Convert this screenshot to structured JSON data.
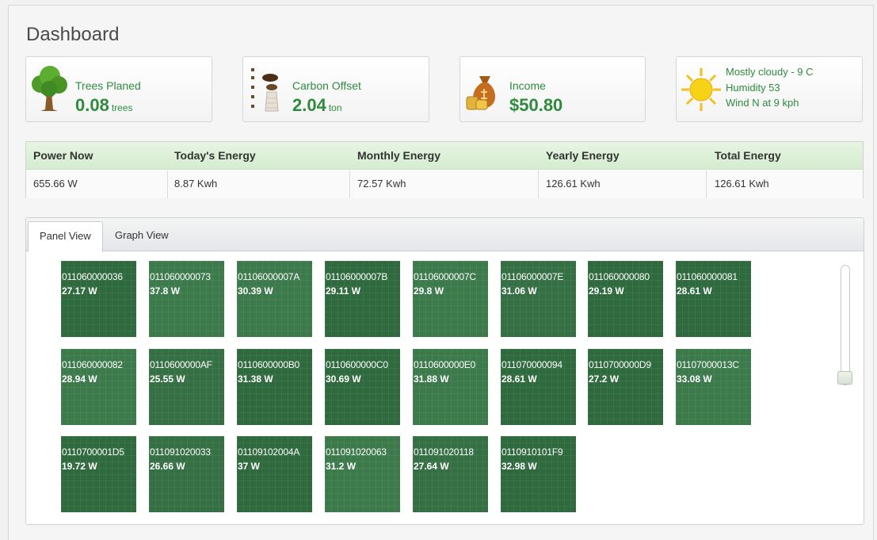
{
  "dashboard": {
    "title": "Dashboard"
  },
  "cards": {
    "trees": {
      "label": "Trees Planed",
      "value": "0.08",
      "unit": "trees",
      "icon": "tree-icon"
    },
    "carbon": {
      "label": "Carbon Offset",
      "value": "2.04",
      "unit": "ton",
      "icon": "factory-smoke-icon"
    },
    "income": {
      "label": "Income",
      "value": "$50.80",
      "icon": "money-bag-icon"
    },
    "weather": {
      "line1": "Mostly cloudy - 9 C",
      "line2": "Humidity 53",
      "line3": "Wind N at 9 kph",
      "icon": "sun-icon"
    }
  },
  "energy": {
    "headers": [
      "Power Now",
      "Today's Energy",
      "Monthly Energy",
      "Yearly Energy",
      "Total Energy"
    ],
    "values": [
      "655.66 W",
      "8.87 Kwh",
      "72.57 Kwh",
      "126.61 Kwh",
      "126.61 Kwh"
    ]
  },
  "tabs": [
    {
      "label": "Panel View",
      "active": true
    },
    {
      "label": "Graph View",
      "active": false
    }
  ],
  "panels": [
    {
      "id": "011060000036",
      "power": "27.17 W"
    },
    {
      "id": "011060000073",
      "power": "37.8 W"
    },
    {
      "id": "01106000007A",
      "power": "30.39 W"
    },
    {
      "id": "01106000007B",
      "power": "29.11 W"
    },
    {
      "id": "01106000007C",
      "power": "29.8 W"
    },
    {
      "id": "01106000007E",
      "power": "31.06 W"
    },
    {
      "id": "011060000080",
      "power": "29.19 W"
    },
    {
      "id": "011060000081",
      "power": "28.61 W"
    },
    {
      "id": "011060000082",
      "power": "28.94 W"
    },
    {
      "id": "0110600000AF",
      "power": "25.55 W"
    },
    {
      "id": "0110600000B0",
      "power": "31.38 W"
    },
    {
      "id": "0110600000C0",
      "power": "30.69 W"
    },
    {
      "id": "0110600000E0",
      "power": "31.88 W"
    },
    {
      "id": "011070000094",
      "power": "28.61 W"
    },
    {
      "id": "0110700000D9",
      "power": "27.2 W"
    },
    {
      "id": "01107000013C",
      "power": "33.08 W"
    },
    {
      "id": "0110700001D5",
      "power": "19.72 W"
    },
    {
      "id": "011091020033",
      "power": "26.66 W"
    },
    {
      "id": "01109102004A",
      "power": "37 W"
    },
    {
      "id": "011091020063",
      "power": "31.2 W"
    },
    {
      "id": "011091020118",
      "power": "27.64 W"
    },
    {
      "id": "0110910101F9",
      "power": "32.98 W"
    }
  ],
  "colors": {
    "accent_green": "#2e8b3e",
    "panel_green": "#3c7a4c",
    "header_green": "#d5eccf"
  }
}
